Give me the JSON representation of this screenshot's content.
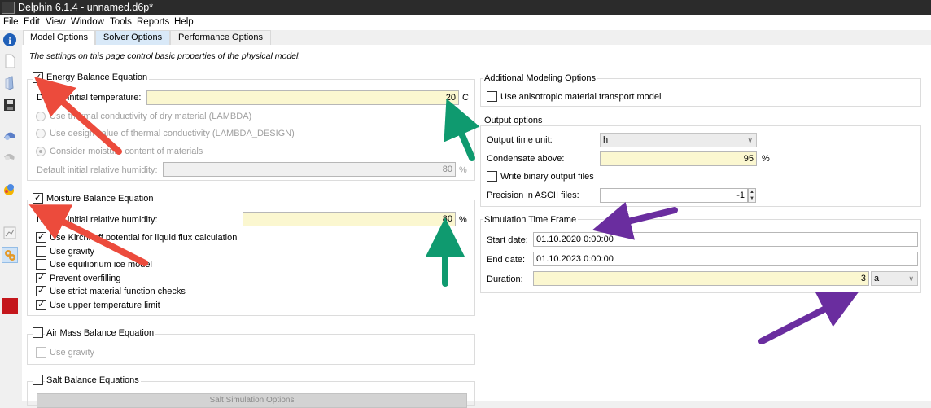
{
  "window": {
    "title": "Delphin 6.1.4 - unnamed.d6p*"
  },
  "menu": [
    "File",
    "Edit",
    "View",
    "Window",
    "Tools",
    "Reports",
    "Help"
  ],
  "toolbar_icons": [
    "info-icon",
    "new-file-icon",
    "open-icon",
    "save-icon",
    "hydraulics-icon",
    "assembly-icon",
    "climate-icon",
    "chart-icon",
    "settings-icon",
    "stop-icon"
  ],
  "tabs": [
    "Model Options",
    "Solver Options",
    "Performance Options"
  ],
  "description": "The settings on this page control basic properties of the physical model.",
  "energy": {
    "title": "Energy Balance Equation",
    "init_temp_label": "Default initial temperature:",
    "init_temp_value": "20",
    "init_temp_unit": "C",
    "radio1": "Use thermal conductivity of dry material (LAMBDA)",
    "radio2": "Use design value of thermal conductivity (LAMBDA_DESIGN)",
    "radio3": "Consider moisture content of materials",
    "rh_label": "Default initial relative humidity:",
    "rh_value": "80",
    "rh_unit": "%"
  },
  "moisture": {
    "title": "Moisture Balance Equation",
    "rh_label": "Default initial relative humidity:",
    "rh_value": "80",
    "rh_unit": "%",
    "options": [
      {
        "label": "Use Kirchhoff potential for liquid flux calculation",
        "checked": true
      },
      {
        "label": "Use gravity",
        "checked": false
      },
      {
        "label": "Use equilibrium ice model",
        "checked": false
      },
      {
        "label": "Prevent overfilling",
        "checked": true
      },
      {
        "label": "Use strict material function checks",
        "checked": true
      },
      {
        "label": "Use upper temperature limit",
        "checked": true
      }
    ]
  },
  "air": {
    "title": "Air Mass Balance Equation",
    "gravity": "Use gravity"
  },
  "salt": {
    "title": "Salt Balance Equations",
    "button": "Salt Simulation Options"
  },
  "additional": {
    "title": "Additional Modeling Options",
    "anisotropic": "Use anisotropic material transport model"
  },
  "output": {
    "title": "Output options",
    "time_unit_label": "Output time unit:",
    "time_unit_value": "h",
    "condensate_label": "Condensate above:",
    "condensate_value": "95",
    "condensate_unit": "%",
    "binary_label": "Write binary output files",
    "precision_label": "Precision in ASCII files:",
    "precision_value": "-1"
  },
  "timeframe": {
    "title": "Simulation Time Frame",
    "start_label": "Start date:",
    "start_value": "01.10.2020  0:00:00",
    "end_label": "End date:",
    "end_value": "01.10.2023  0:00:00",
    "duration_label": "Duration:",
    "duration_value": "3",
    "duration_unit": "a"
  },
  "colors": {
    "red_arrow": "#ec4b3c",
    "green_arrow": "#0f9a6f",
    "purple_arrow": "#6a2d9f",
    "yellow_field": "#fbf7d0"
  }
}
